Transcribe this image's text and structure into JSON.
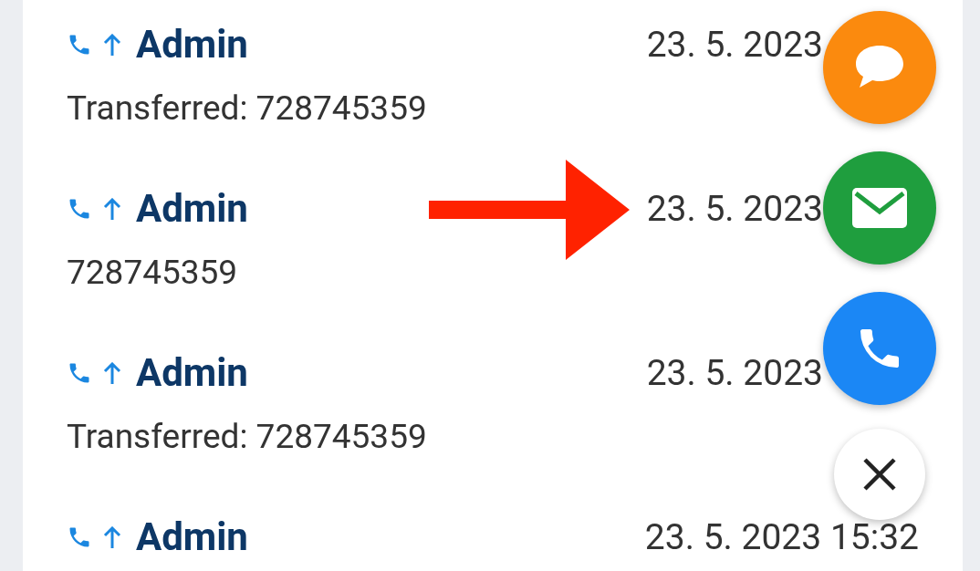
{
  "calls": [
    {
      "name": "Admin",
      "detail": "Transferred: 728745359",
      "date": "23. 5. 2023"
    },
    {
      "name": "Admin",
      "detail": "728745359",
      "date": "23. 5. 2023"
    },
    {
      "name": "Admin",
      "detail": "Transferred: 728745359",
      "date": "23. 5. 2023"
    },
    {
      "name": "Admin",
      "date": "23. 5. 2023 15:32"
    }
  ],
  "fabs": [
    {
      "kind": "chat"
    },
    {
      "kind": "email"
    },
    {
      "kind": "call"
    },
    {
      "kind": "close"
    }
  ]
}
